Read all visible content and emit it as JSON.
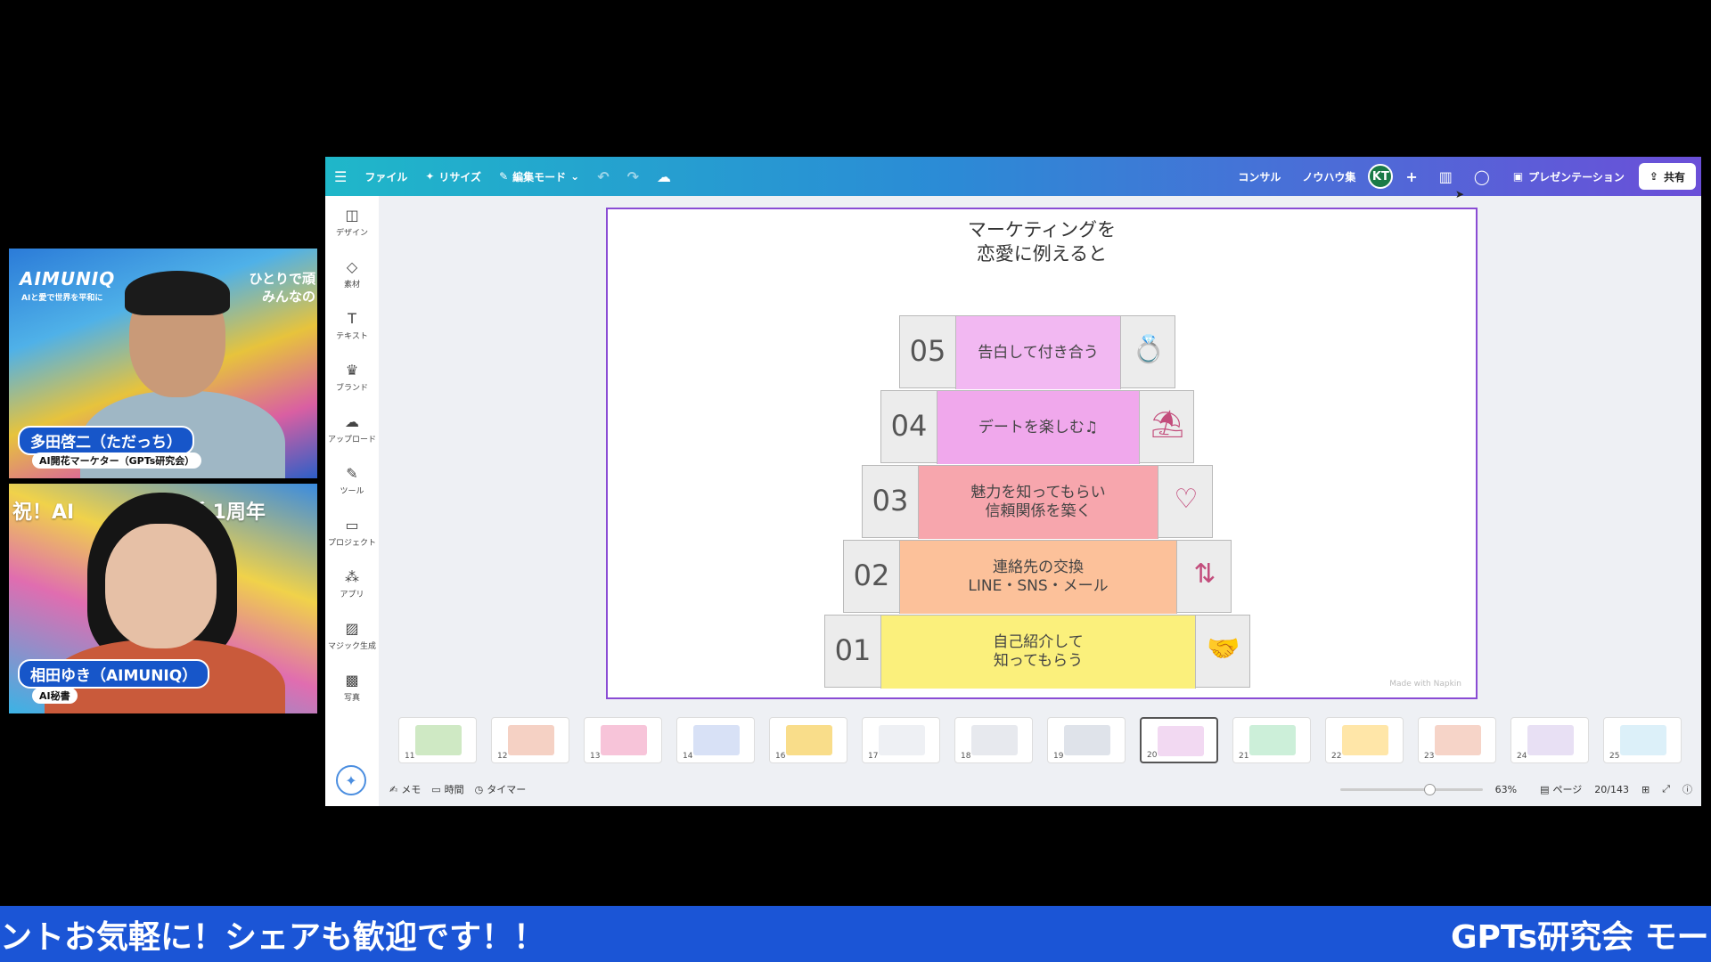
{
  "participants": [
    {
      "name": "多田啓二（ただっち）",
      "role": "AI開花マーケター（GPTs研究会）",
      "bg_brand": "AIMUNIQ",
      "bg_brand_sub": "AIと愛で世界を平和に",
      "bg_tag_line1": "ひとりで頑",
      "bg_tag_line2": "みんなの"
    },
    {
      "name": "相田ゆき（AIMUNIQ）",
      "role": "AI秘書",
      "bg_banner": "祝！AI",
      "bg_banner_right": "朝活 1周年"
    }
  ],
  "toolbar": {
    "file": "ファイル",
    "resize": "リサイズ",
    "edit_mode": "編集モード",
    "consult": "コンサル",
    "knowhow": "ノウハウ集",
    "avatar": "KT",
    "present": "プレゼンテーション",
    "share": "共有"
  },
  "sidebar": {
    "items": [
      {
        "label": "デザイン",
        "icon": "layout-icon"
      },
      {
        "label": "素材",
        "icon": "shapes-icon"
      },
      {
        "label": "テキスト",
        "icon": "text-icon"
      },
      {
        "label": "ブランド",
        "icon": "brand-icon"
      },
      {
        "label": "アップロード",
        "icon": "upload-icon"
      },
      {
        "label": "ツール",
        "icon": "pen-icon"
      },
      {
        "label": "プロジェクト",
        "icon": "folder-icon"
      },
      {
        "label": "アプリ",
        "icon": "apps-icon"
      },
      {
        "label": "マジック生成",
        "icon": "magic-image-icon"
      },
      {
        "label": "写真",
        "icon": "photo-icon"
      }
    ]
  },
  "slide": {
    "title_line1": "マーケティングを",
    "title_line2": "恋愛に例えると",
    "watermark": "Made with Napkin",
    "steps": [
      {
        "num": "05",
        "line1": "告白して付き合う",
        "line2": "",
        "color": "#f2b8f2",
        "icon": "ring-icon",
        "glyph": "💍"
      },
      {
        "num": "04",
        "line1": "デートを楽しむ♫",
        "line2": "",
        "color": "#f0a8ec",
        "icon": "picnic-table-icon",
        "glyph": "⛱"
      },
      {
        "num": "03",
        "line1": "魅力を知ってもらい",
        "line2": "信頼関係を築く",
        "color": "#f7a6ad",
        "icon": "person-heart-icon",
        "glyph": "♡"
      },
      {
        "num": "02",
        "line1": "連絡先の交換",
        "line2": "LINE・SNS・メール",
        "color": "#fcc19a",
        "icon": "exchange-arrows-icon",
        "glyph": "⇅"
      },
      {
        "num": "01",
        "line1": "自己紹介して",
        "line2": "知ってもらう",
        "color": "#fbf07c",
        "icon": "handshake-icon",
        "glyph": "🤝"
      }
    ]
  },
  "thumbnails": [
    "11",
    "12",
    "13",
    "14",
    "16",
    "17",
    "18",
    "19",
    "20",
    "21",
    "22",
    "23",
    "24",
    "25"
  ],
  "footer": {
    "notes": "メモ",
    "time": "時間",
    "timer": "タイマー",
    "zoom": "63%",
    "zoom_level": 0.63,
    "page_label": "ページ",
    "page_count": "20/143"
  },
  "ticker": {
    "left": "ントお気軽に！シェアも歓迎です！！",
    "right": "GPTs研究会 モー"
  }
}
